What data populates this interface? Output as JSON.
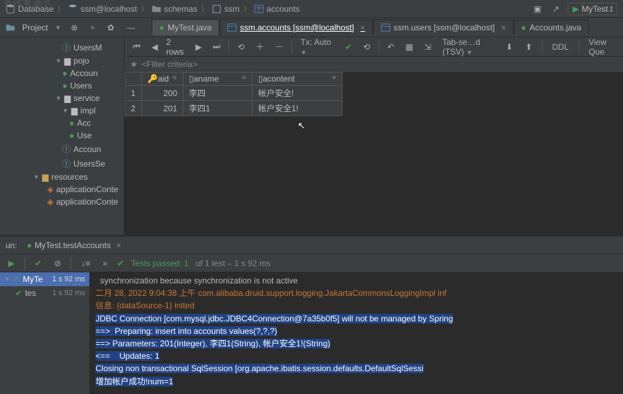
{
  "ghost_title": "务效果演示",
  "breadcrumb": {
    "items": [
      "Database",
      "ssm@localhost",
      "schemas",
      "ssm",
      "accounts"
    ]
  },
  "breadcrumb_run": "MyTest.t",
  "project_label": "Project",
  "tabs": [
    {
      "label": "MyTest.java",
      "type": "java",
      "active": true
    },
    {
      "label": "ssm.accounts [ssm@localhost]",
      "type": "table",
      "highlighted": true
    },
    {
      "label": "ssm.users [ssm@localhost]",
      "type": "table"
    },
    {
      "label": "Accounts.java",
      "type": "java"
    }
  ],
  "tree": {
    "top": "UsersM",
    "pojo": "pojo",
    "pojo_children": [
      "Accoun",
      "Users"
    ],
    "service": "service",
    "impl": "impl",
    "impl_children": [
      "Acc",
      "Use",
      "Accoun",
      "UsersSe"
    ],
    "resources": "resources",
    "resources_children": [
      "applicationConte",
      "applicationConte"
    ]
  },
  "data_toolbar": {
    "rows": "2 rows",
    "tx": "Tx: Auto",
    "tab_setting": "Tab-se…d (TSV)",
    "ddl": "DDL",
    "view_query": "View Que"
  },
  "filter_placeholder": "<Filter criteria>",
  "columns": [
    "aid",
    "aname",
    "acontent"
  ],
  "rows": [
    {
      "n": "1",
      "aid": "200",
      "aname": "李四",
      "acontent": "帐户安全!"
    },
    {
      "n": "2",
      "aid": "201",
      "aname": "李四1",
      "acontent": "帐户安全1!"
    }
  ],
  "run": {
    "label": "un:",
    "tab": "MyTest.testAccounts",
    "tests_passed": "Tests passed: 1",
    "tests_rest": " of 1 test – 1 s 92 ms",
    "left_item": "MyTe",
    "left_time": "1 s 92 ms",
    "left_sub": "tes",
    "left_sub_time": "1 s 92 ms"
  },
  "console": {
    "l1": "  synchronization because synchronization is not active",
    "l2": "二月 28, 2022 9:04:38 上午 com.alibaba.druid.support.logging.JakartaCommonsLoggingImpl inf",
    "l3": "信息: {dataSource-1} inited",
    "l4": "JDBC Connection [com.mysql.jdbc.JDBC4Connection@7a35b0f5] will not be managed by Spring",
    "l5": "==>  Preparing: insert into accounts values(?,?,?)",
    "l6": "==> Parameters: 201(Integer), 李四1(String), 帐户安全1!(String)",
    "l7": "<==    Updates: 1",
    "l8": "Closing non transactional SqlSession [org.apache.ibatis.session.defaults.DefaultSqlSessi",
    "l9": "增加帐户成功!num=1"
  }
}
